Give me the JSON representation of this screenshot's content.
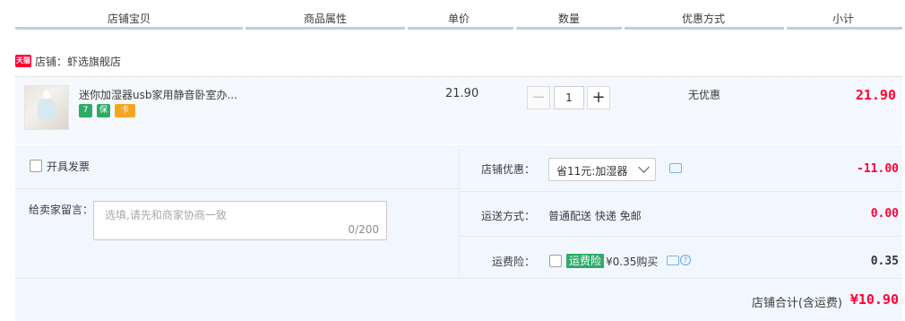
{
  "header": {
    "columns": [
      "店铺宝贝",
      "商品属性",
      "单价",
      "数量",
      "优惠方式",
      "小计"
    ]
  },
  "shop": {
    "badge": "天猫",
    "label": "店铺：虾选旗舰店"
  },
  "item": {
    "title": "迷你加湿器usb家用静音卧室办...",
    "unit_price": "21.90",
    "quantity": "1",
    "promo": "无优惠",
    "subtotal": "21.90",
    "badges": [
      "7",
      "保",
      "卡"
    ]
  },
  "invoice": {
    "label": "开具发票"
  },
  "message": {
    "label": "给卖家留言：",
    "placeholder": "选填,请先和商家协商一致",
    "counter": "0/200"
  },
  "shop_discount": {
    "label": "店铺优惠：",
    "selected": "省11元:加湿器",
    "amount": "-11.00"
  },
  "delivery": {
    "label": "运送方式：",
    "value": "普通配送 快递 免邮",
    "amount": "0.00"
  },
  "insurance": {
    "label": "运费险：",
    "tag": "运费险",
    "price_text": "¥0.35购买",
    "amount": "0.35"
  },
  "total": {
    "label": "店铺合计(含运费)",
    "value": "¥10.90"
  },
  "colors": {
    "price_red": "#ff0036",
    "panel_bg": "#f2f7ff",
    "header_line": "#b8cfe6",
    "insurance_green": "#2eab68"
  }
}
